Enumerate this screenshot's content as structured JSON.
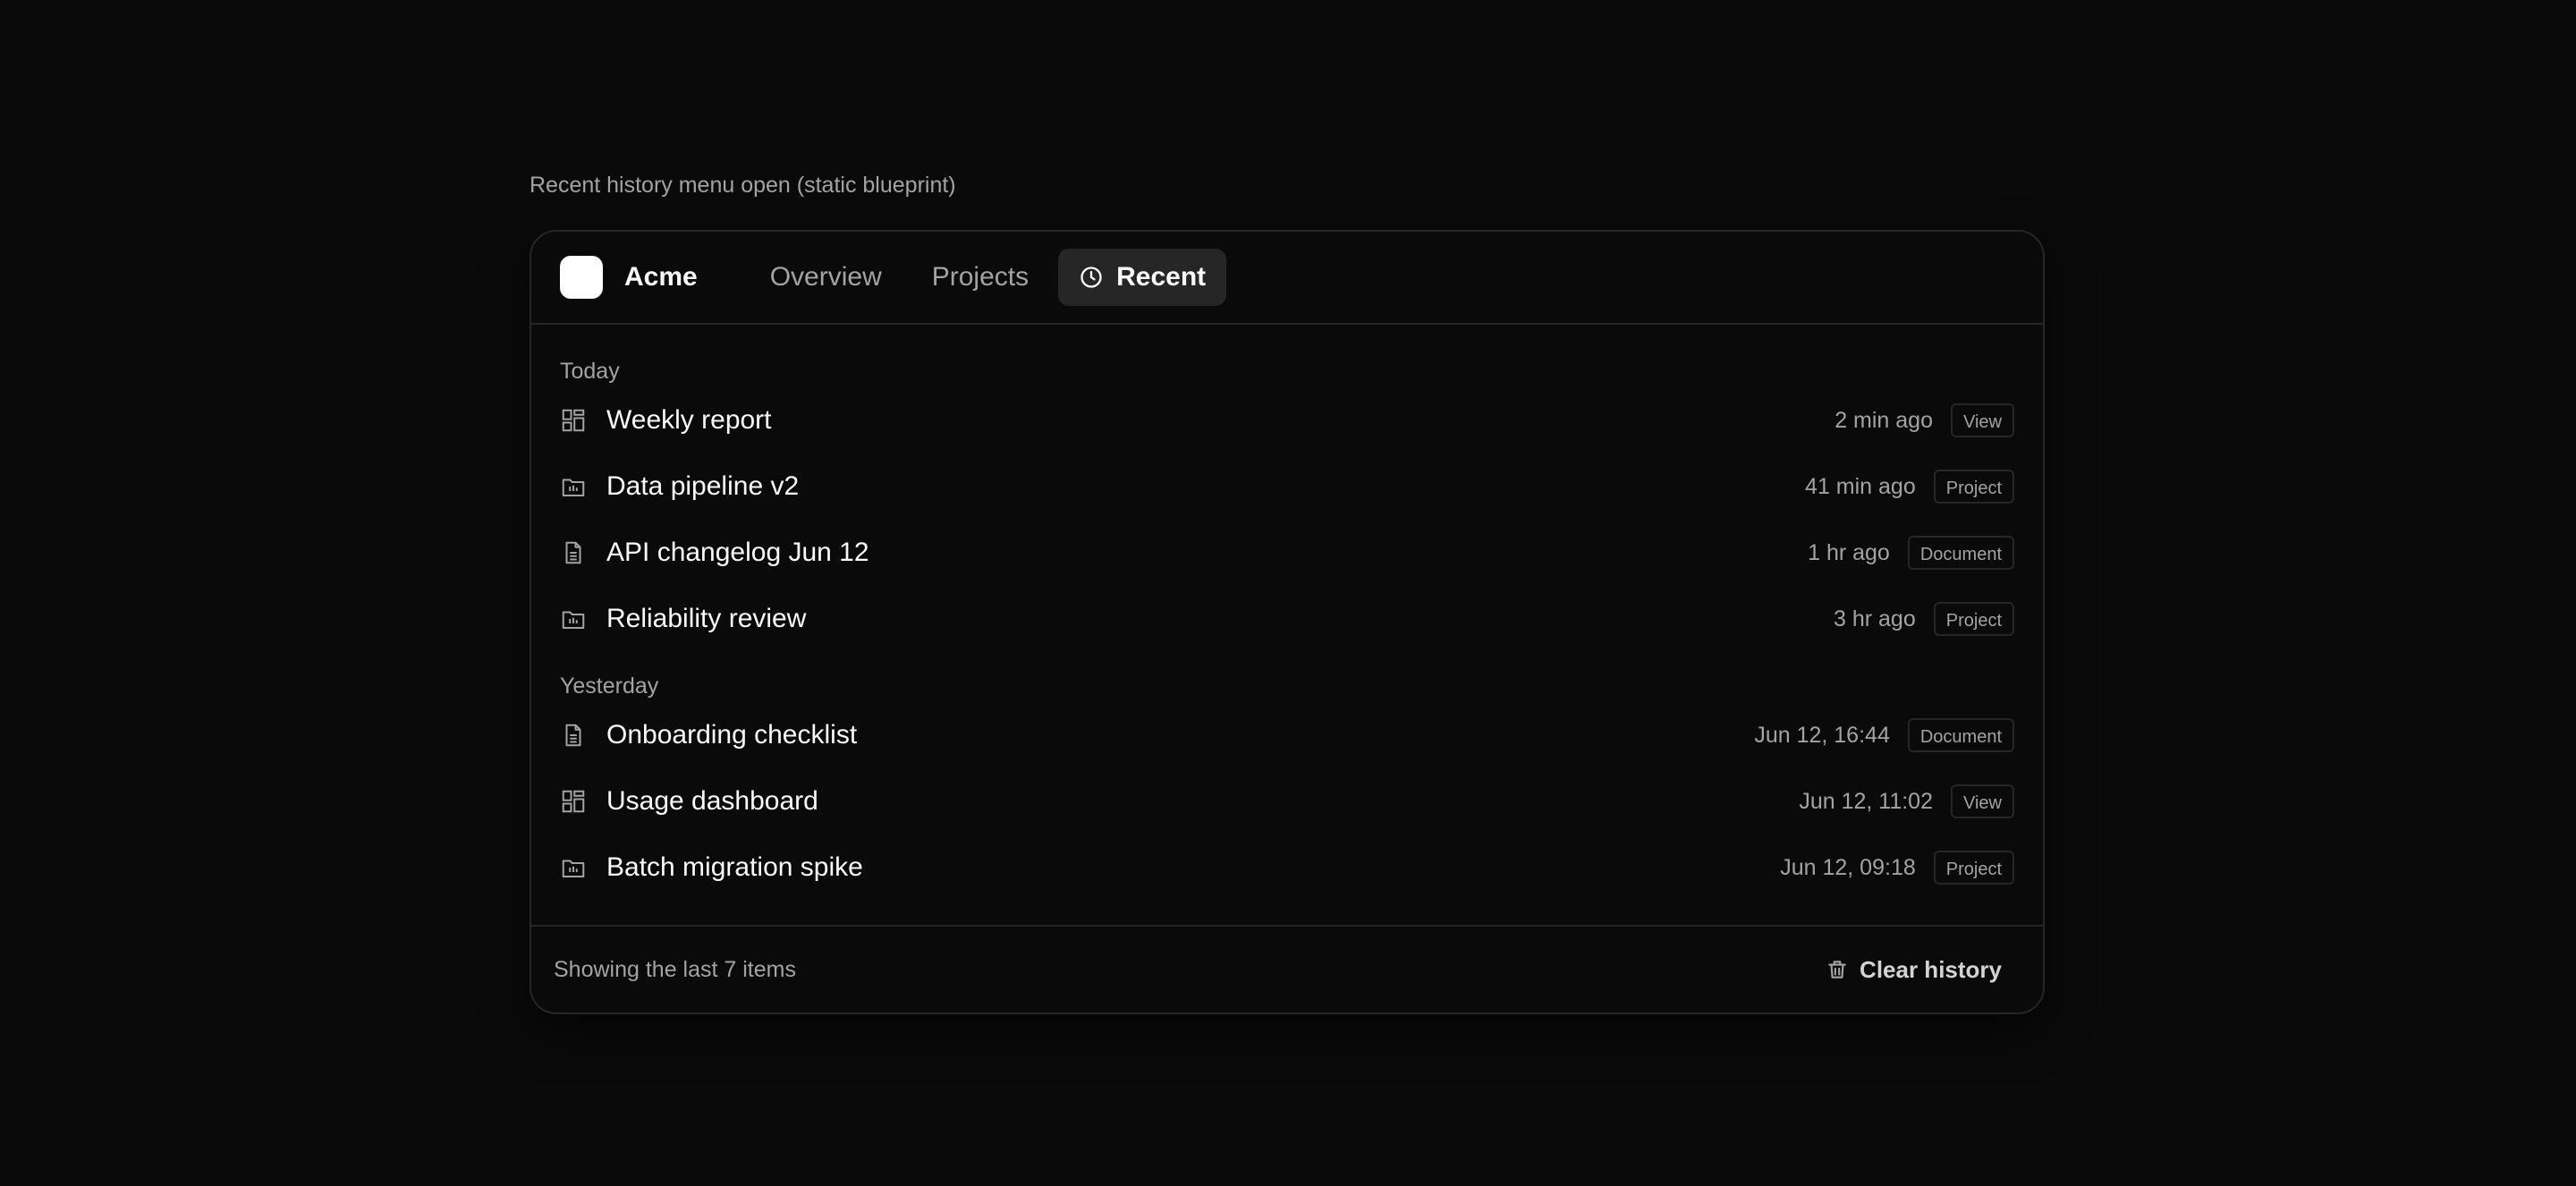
{
  "caption": "Recent history menu open (static blueprint)",
  "header": {
    "brand": "Acme",
    "nav": [
      {
        "label": "Overview"
      },
      {
        "label": "Projects"
      },
      {
        "label": "Recent"
      }
    ]
  },
  "sections": [
    {
      "label": "Today",
      "items": [
        {
          "icon": "view-grid-icon",
          "name": "Weekly report",
          "time": "2 min ago",
          "badge": "View"
        },
        {
          "icon": "project-folder-icon",
          "name": "Data pipeline v2",
          "time": "41 min ago",
          "badge": "Project"
        },
        {
          "icon": "document-icon",
          "name": "API changelog Jun 12",
          "time": "1 hr ago",
          "badge": "Document"
        },
        {
          "icon": "project-folder-icon",
          "name": "Reliability review",
          "time": "3 hr ago",
          "badge": "Project"
        }
      ]
    },
    {
      "label": "Yesterday",
      "items": [
        {
          "icon": "document-icon",
          "name": "Onboarding checklist",
          "time": "Jun 12, 16:44",
          "badge": "Document"
        },
        {
          "icon": "view-grid-icon",
          "name": "Usage dashboard",
          "time": "Jun 12, 11:02",
          "badge": "View"
        },
        {
          "icon": "project-folder-icon",
          "name": "Batch migration spike",
          "time": "Jun 12, 09:18",
          "badge": "Project"
        }
      ]
    }
  ],
  "footer": {
    "count_text": "Showing the last 7 items",
    "clear_label": "Clear history"
  },
  "colors": {
    "background": "#0a0a0a",
    "border": "#262626",
    "text": "#fafafa",
    "muted": "#a3a3a3",
    "active_tab": "#262626"
  }
}
